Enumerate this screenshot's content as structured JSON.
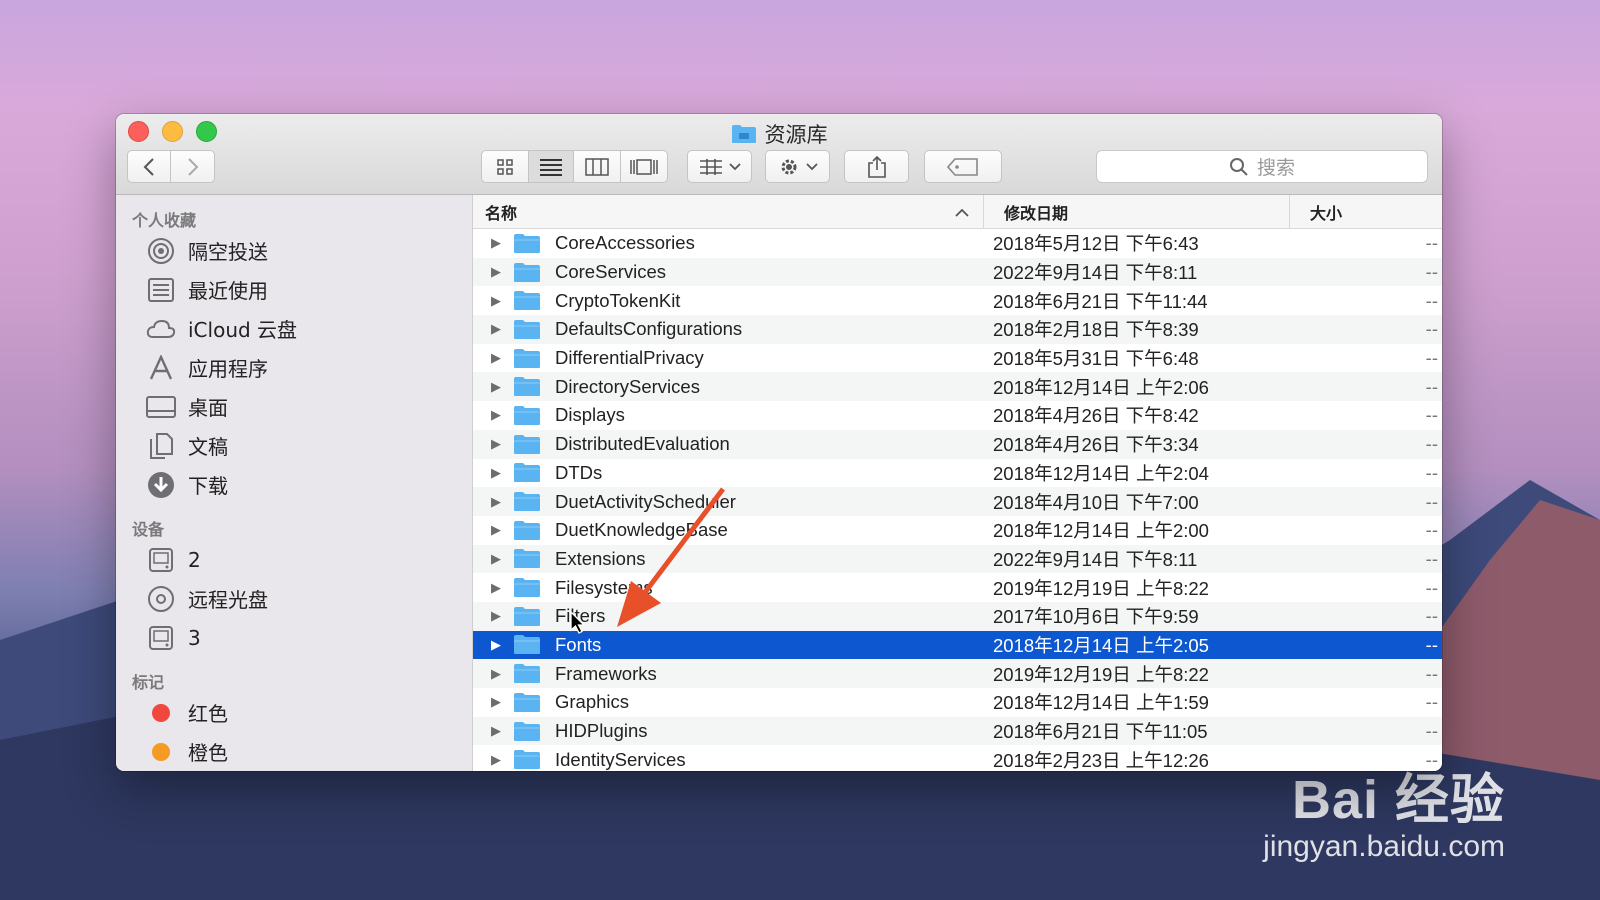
{
  "window": {
    "title": "资源库",
    "search_placeholder": "搜索"
  },
  "sidebar": {
    "favorites_header": "个人收藏",
    "favorites": [
      {
        "label": "隔空投送",
        "icon": "airdrop-icon"
      },
      {
        "label": "最近使用",
        "icon": "recents-icon"
      },
      {
        "label": "iCloud 云盘",
        "icon": "icloud-icon"
      },
      {
        "label": "应用程序",
        "icon": "applications-icon"
      },
      {
        "label": "桌面",
        "icon": "desktop-icon"
      },
      {
        "label": "文稿",
        "icon": "documents-icon"
      },
      {
        "label": "下载",
        "icon": "downloads-icon"
      }
    ],
    "devices_header": "设备",
    "devices": [
      {
        "label": "2",
        "icon": "disk-icon"
      },
      {
        "label": "远程光盘",
        "icon": "optical-disc-icon"
      },
      {
        "label": "3",
        "icon": "disk-icon"
      }
    ],
    "tags_header": "标记",
    "tags": [
      {
        "label": "红色",
        "color": "#f0473f"
      },
      {
        "label": "橙色",
        "color": "#f59a23"
      }
    ]
  },
  "columns": {
    "name": "名称",
    "date": "修改日期",
    "size": "大小"
  },
  "rows": [
    {
      "name": "CoreAccessories",
      "date": "2018年5月12日 下午6:43",
      "size": "--"
    },
    {
      "name": "CoreServices",
      "date": "2022年9月14日 下午8:11",
      "size": "--"
    },
    {
      "name": "CryptoTokenKit",
      "date": "2018年6月21日 下午11:44",
      "size": "--"
    },
    {
      "name": "DefaultsConfigurations",
      "date": "2018年2月18日 下午8:39",
      "size": "--"
    },
    {
      "name": "DifferentialPrivacy",
      "date": "2018年5月31日 下午6:48",
      "size": "--"
    },
    {
      "name": "DirectoryServices",
      "date": "2018年12月14日 上午2:06",
      "size": "--"
    },
    {
      "name": "Displays",
      "date": "2018年4月26日 下午8:42",
      "size": "--"
    },
    {
      "name": "DistributedEvaluation",
      "date": "2018年4月26日 下午3:34",
      "size": "--"
    },
    {
      "name": "DTDs",
      "date": "2018年12月14日 上午2:04",
      "size": "--"
    },
    {
      "name": "DuetActivityScheduler",
      "date": "2018年4月10日 下午7:00",
      "size": "--"
    },
    {
      "name": "DuetKnowledgeBase",
      "date": "2018年12月14日 上午2:00",
      "size": "--"
    },
    {
      "name": "Extensions",
      "date": "2022年9月14日 下午8:11",
      "size": "--"
    },
    {
      "name": "Filesystems",
      "date": "2019年12月19日 上午8:22",
      "size": "--"
    },
    {
      "name": "Filters",
      "date": "2017年10月6日 下午9:59",
      "size": "--"
    },
    {
      "name": "Fonts",
      "date": "2018年12月14日 上午2:05",
      "size": "--",
      "selected": true
    },
    {
      "name": "Frameworks",
      "date": "2019年12月19日 上午8:22",
      "size": "--"
    },
    {
      "name": "Graphics",
      "date": "2018年12月14日 上午1:59",
      "size": "--"
    },
    {
      "name": "HIDPlugins",
      "date": "2018年6月21日 下午11:05",
      "size": "--"
    },
    {
      "name": "IdentityServices",
      "date": "2018年2月23日 上午12:26",
      "size": "--"
    }
  ],
  "watermark": {
    "top": "Bai 经验",
    "bottom": "jingyan.baidu.com"
  },
  "colors": {
    "selection": "#0d58d0",
    "folder": "#5ab4f2",
    "annotation_arrow": "#e8502a"
  }
}
